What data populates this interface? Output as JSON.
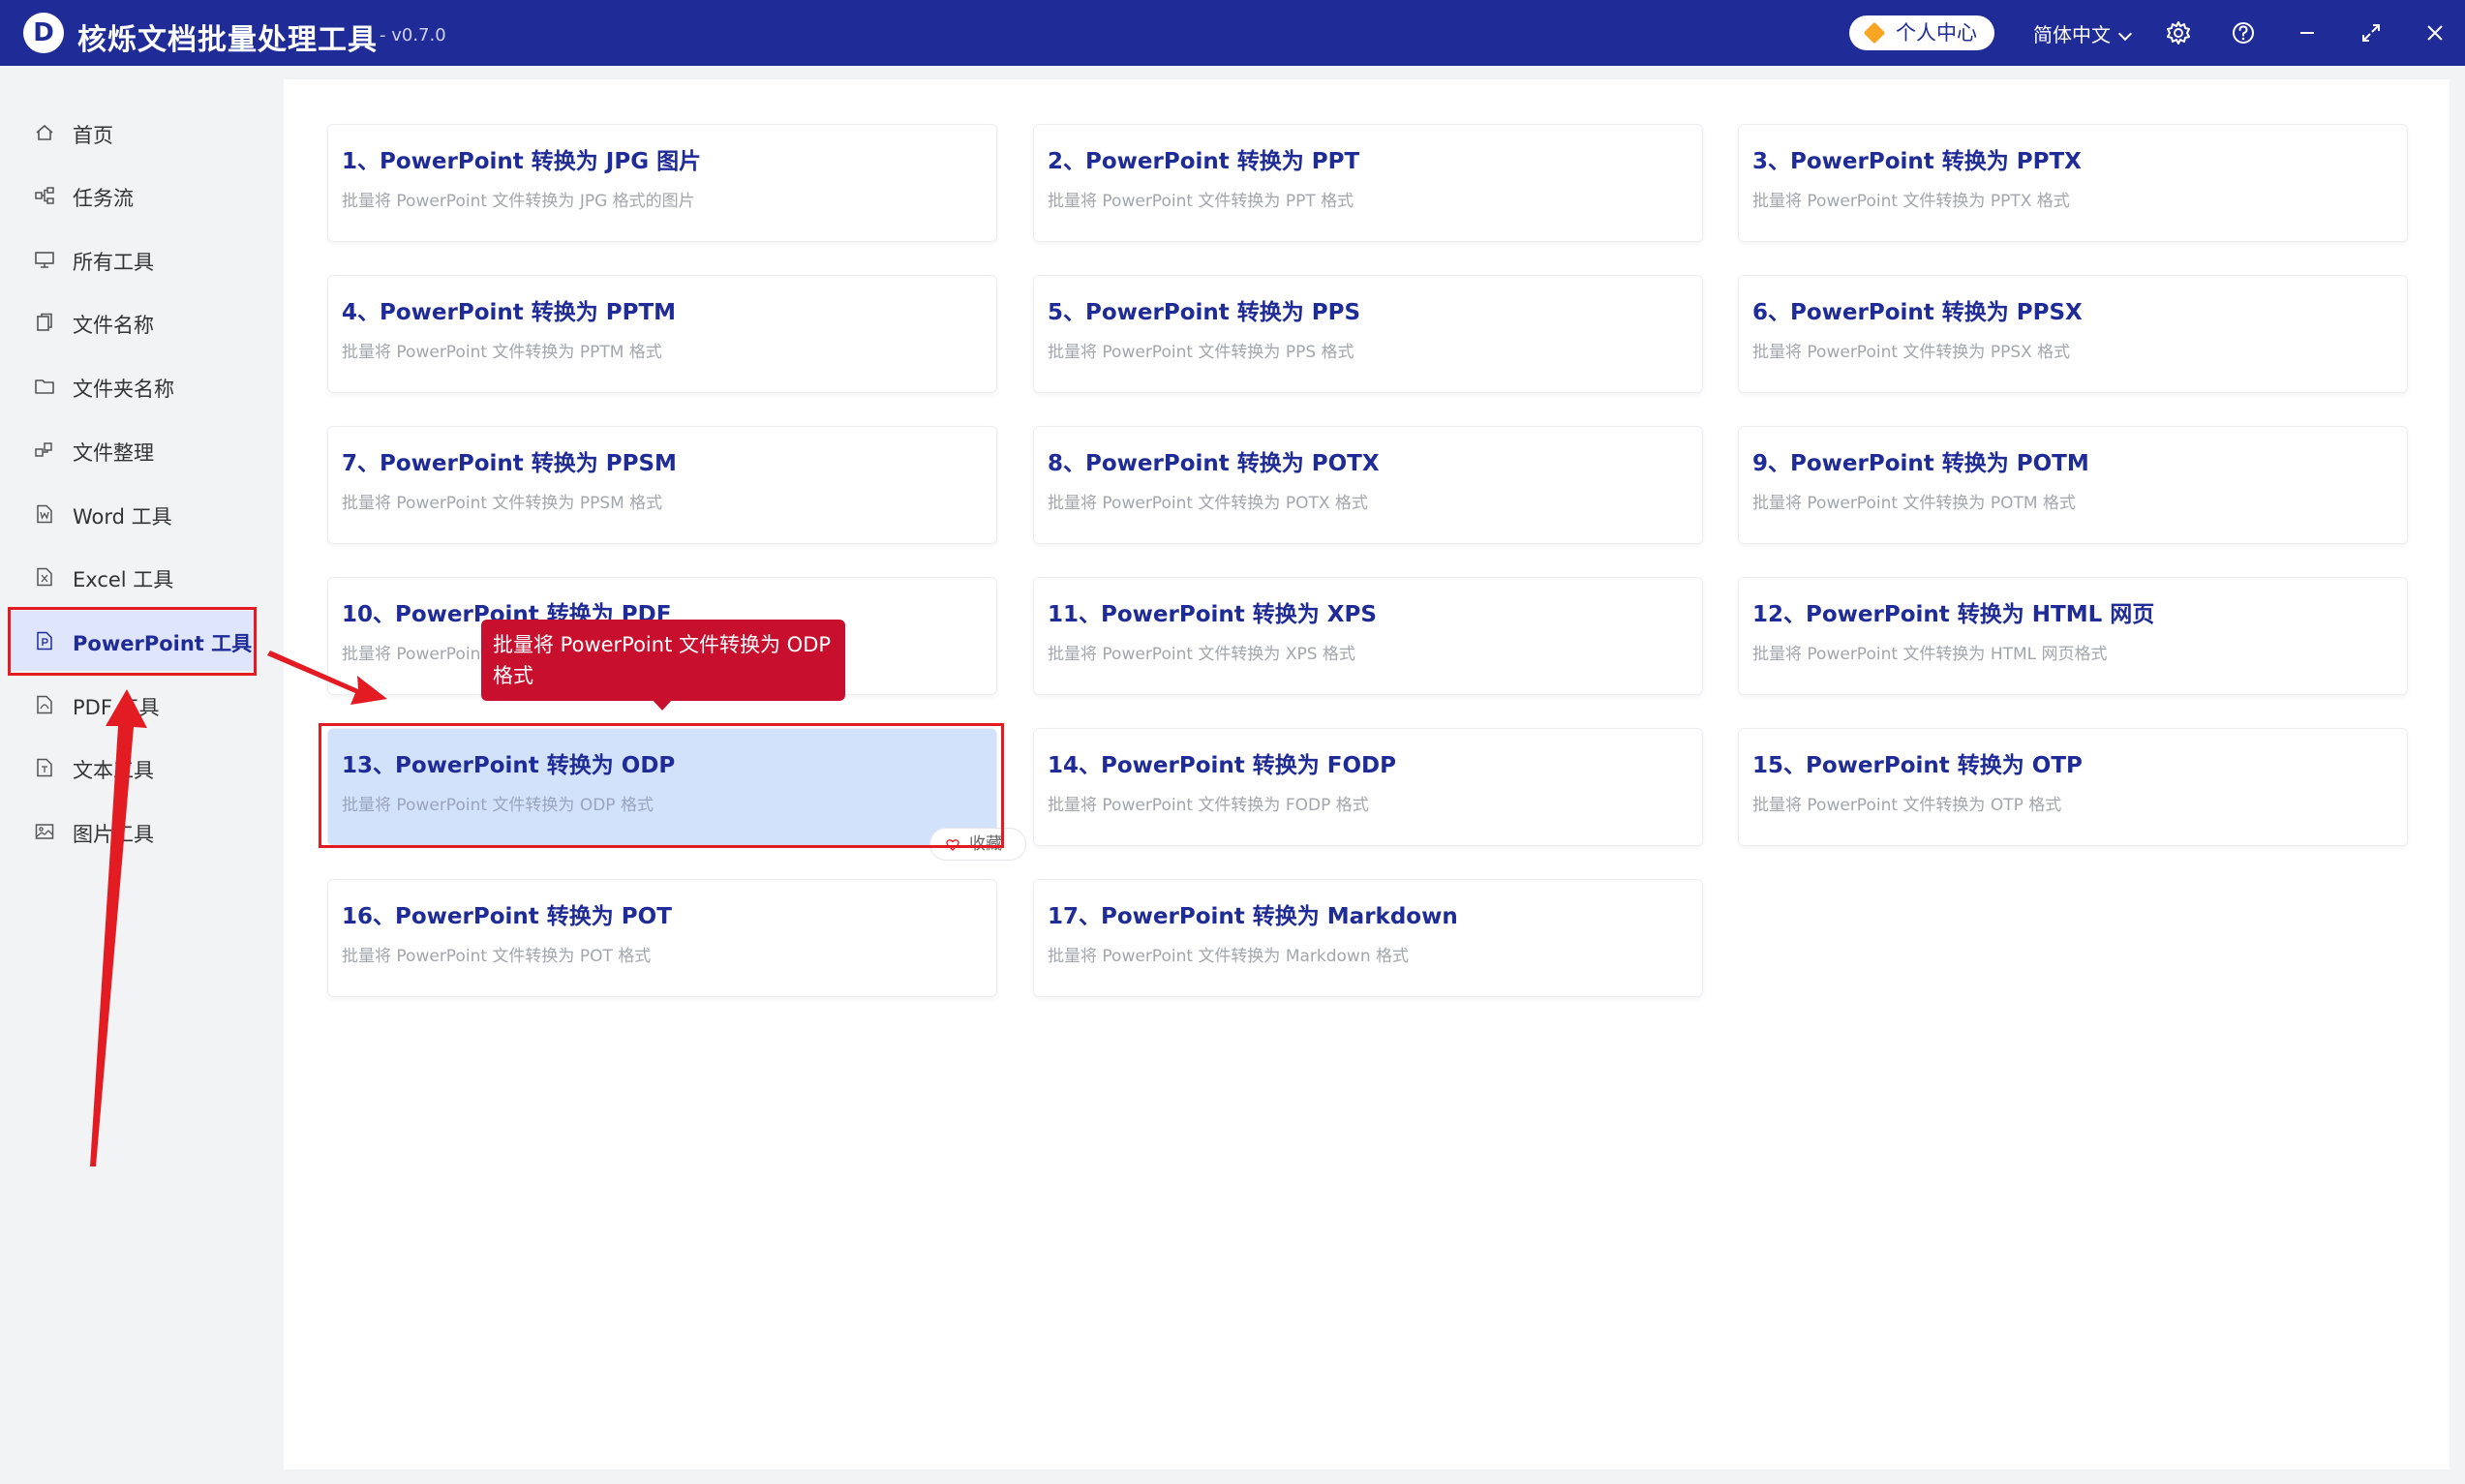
{
  "app": {
    "logo_letter": "D",
    "title": "核烁文档批量处理工具",
    "version": "- v0.7.0"
  },
  "titlebar": {
    "personal_center": "个人中心",
    "language": "简体中文"
  },
  "sidebar": {
    "items": [
      {
        "label": "首页",
        "icon": "home-icon"
      },
      {
        "label": "任务流",
        "icon": "workflow-icon"
      },
      {
        "label": "所有工具",
        "icon": "monitor-icon"
      },
      {
        "label": "文件名称",
        "icon": "file-copy-icon"
      },
      {
        "label": "文件夹名称",
        "icon": "folder-icon"
      },
      {
        "label": "文件整理",
        "icon": "organize-icon"
      },
      {
        "label": "Word 工具",
        "icon": "word-file-icon"
      },
      {
        "label": "Excel 工具",
        "icon": "excel-file-icon"
      },
      {
        "label": "PowerPoint 工具",
        "icon": "ppt-file-icon"
      },
      {
        "label": "PDF 工具",
        "icon": "pdf-file-icon"
      },
      {
        "label": "文本工具",
        "icon": "text-file-icon"
      },
      {
        "label": "图片工具",
        "icon": "image-icon"
      }
    ],
    "active_index": 8
  },
  "cards": [
    {
      "title": "1、PowerPoint 转换为 JPG 图片",
      "desc": "批量将 PowerPoint 文件转换为 JPG 格式的图片"
    },
    {
      "title": "2、PowerPoint 转换为 PPT",
      "desc": "批量将 PowerPoint 文件转换为 PPT 格式"
    },
    {
      "title": "3、PowerPoint 转换为 PPTX",
      "desc": "批量将 PowerPoint 文件转换为 PPTX 格式"
    },
    {
      "title": "4、PowerPoint 转换为 PPTM",
      "desc": "批量将 PowerPoint 文件转换为 PPTM 格式"
    },
    {
      "title": "5、PowerPoint 转换为 PPS",
      "desc": "批量将 PowerPoint 文件转换为 PPS 格式"
    },
    {
      "title": "6、PowerPoint 转换为 PPSX",
      "desc": "批量将 PowerPoint 文件转换为 PPSX 格式"
    },
    {
      "title": "7、PowerPoint 转换为 PPSM",
      "desc": "批量将 PowerPoint 文件转换为 PPSM 格式"
    },
    {
      "title": "8、PowerPoint 转换为 POTX",
      "desc": "批量将 PowerPoint 文件转换为 POTX 格式"
    },
    {
      "title": "9、PowerPoint 转换为 POTM",
      "desc": "批量将 PowerPoint 文件转换为 POTM 格式"
    },
    {
      "title": "10、PowerPoint 转换为 PDF",
      "desc": "批量将 PowerPoint 文件转换为 PDF 格式"
    },
    {
      "title": "11、PowerPoint 转换为 XPS",
      "desc": "批量将 PowerPoint 文件转换为 XPS 格式"
    },
    {
      "title": "12、PowerPoint 转换为 HTML 网页",
      "desc": "批量将 PowerPoint 文件转换为 HTML 网页格式"
    },
    {
      "title": "13、PowerPoint 转换为 ODP",
      "desc": "批量将 PowerPoint 文件转换为 ODP 格式"
    },
    {
      "title": "14、PowerPoint 转换为 FODP",
      "desc": "批量将 PowerPoint 文件转换为 FODP 格式"
    },
    {
      "title": "15、PowerPoint 转换为 OTP",
      "desc": "批量将 PowerPoint 文件转换为 OTP 格式"
    },
    {
      "title": "16、PowerPoint 转换为 POT",
      "desc": "批量将 PowerPoint 文件转换为 POT 格式"
    },
    {
      "title": "17、PowerPoint 转换为 Markdown",
      "desc": "批量将 PowerPoint 文件转换为 Markdown 格式"
    }
  ],
  "hovered_card_index": 12,
  "favorite_label": "收藏",
  "tooltip": {
    "text": "批量将 PowerPoint 文件转换为 ODP 格式"
  },
  "colors": {
    "brand": "#1f2b96",
    "highlight": "#e31b23",
    "tooltip_bg": "#c8102e",
    "hover_card": "#d3e2fb"
  }
}
